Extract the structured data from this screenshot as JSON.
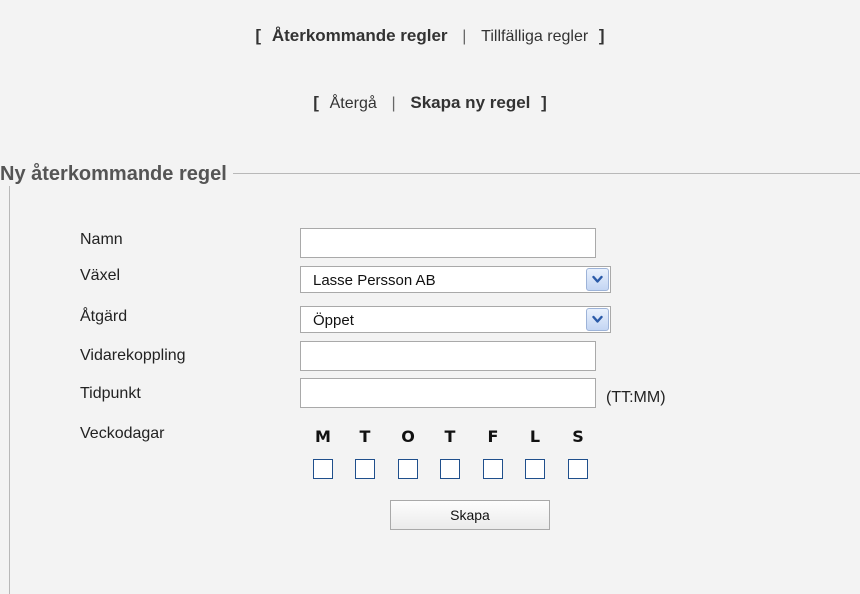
{
  "nav_tabs": {
    "open_bracket": "[",
    "recurring": "Återkommande regler",
    "separator": "|",
    "temporary": "Tillfälliga regler",
    "close_bracket": "]"
  },
  "nav_actions": {
    "open_bracket": "[",
    "back": "Återgå",
    "separator": "|",
    "create_new": "Skapa ny regel",
    "close_bracket": "]"
  },
  "form": {
    "legend": "Ny återkommande regel",
    "fields": {
      "name": {
        "label": "Namn",
        "value": ""
      },
      "switchboard": {
        "label": "Växel",
        "value": "Lasse Persson AB"
      },
      "action": {
        "label": "Åtgärd",
        "value": "Öppet"
      },
      "forwarding": {
        "label": "Vidarekoppling",
        "value": ""
      },
      "time": {
        "label": "Tidpunkt",
        "value": "",
        "hint": "(TT:MM)"
      },
      "weekdays": {
        "label": "Veckodagar"
      }
    },
    "days": [
      "M",
      "T",
      "O",
      "T",
      "F",
      "L",
      "S"
    ],
    "submit_label": "Skapa"
  },
  "colors": {
    "background": "#f3f3f3",
    "checkbox_border": "#1f4f8c",
    "dropdown_arrow": "#2a5aa8"
  }
}
